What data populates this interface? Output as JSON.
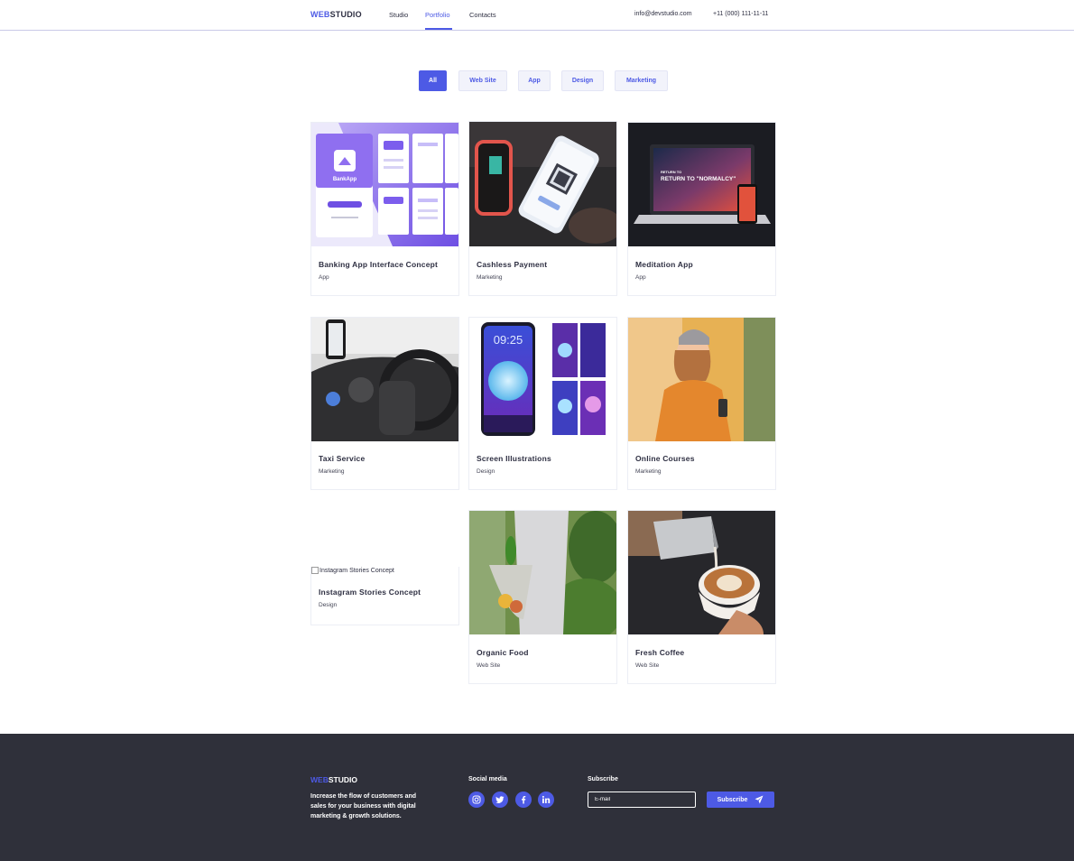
{
  "header": {
    "logo_primary": "WEB",
    "logo_secondary": "STUDIO",
    "nav": [
      "Studio",
      "Portfolio",
      "Contacts"
    ],
    "active_nav": "Portfolio",
    "email": "info@devstudio.com",
    "phone": "+11 (000) 111-11-11"
  },
  "filters": {
    "items": [
      "All",
      "Web Site",
      "App",
      "Design",
      "Marketing"
    ],
    "active": "All"
  },
  "portfolio": [
    {
      "title": "Banking App Interface Concept",
      "category": "App"
    },
    {
      "title": "Cashless Payment",
      "category": "Marketing"
    },
    {
      "title": "Meditation App",
      "category": "App"
    },
    {
      "title": "Taxi Service",
      "category": "Marketing"
    },
    {
      "title": "Screen Illustrations",
      "category": "Design"
    },
    {
      "title": "Online Courses",
      "category": "Marketing"
    },
    {
      "title": "Instagram Stories Concept",
      "category": "Design",
      "image_alt": "Instagram Stories Concept"
    },
    {
      "title": "Organic Food",
      "category": "Web Site"
    },
    {
      "title": "Fresh Coffee",
      "category": "Web Site"
    }
  ],
  "image_texts": {
    "bank_app_logo": "BankApp",
    "meditation_headline": "RETURN TO \"NORMALCY\"",
    "phone_time": "09:25"
  },
  "footer": {
    "logo_primary": "WEB",
    "logo_secondary": "STUDIO",
    "description": "Increase the flow of customers and sales for your business with digital marketing & growth solutions.",
    "social_heading": "Social media",
    "social": [
      "instagram-icon",
      "twitter-icon",
      "facebook-icon",
      "linkedin-icon"
    ],
    "subscribe_heading": "Subscribe",
    "email_placeholder": "E-mail",
    "subscribe_label": "Subscribe"
  },
  "colors": {
    "accent": "#4d5ae5",
    "text_dark": "#2e2f42",
    "footer_bg": "#2f303a"
  }
}
